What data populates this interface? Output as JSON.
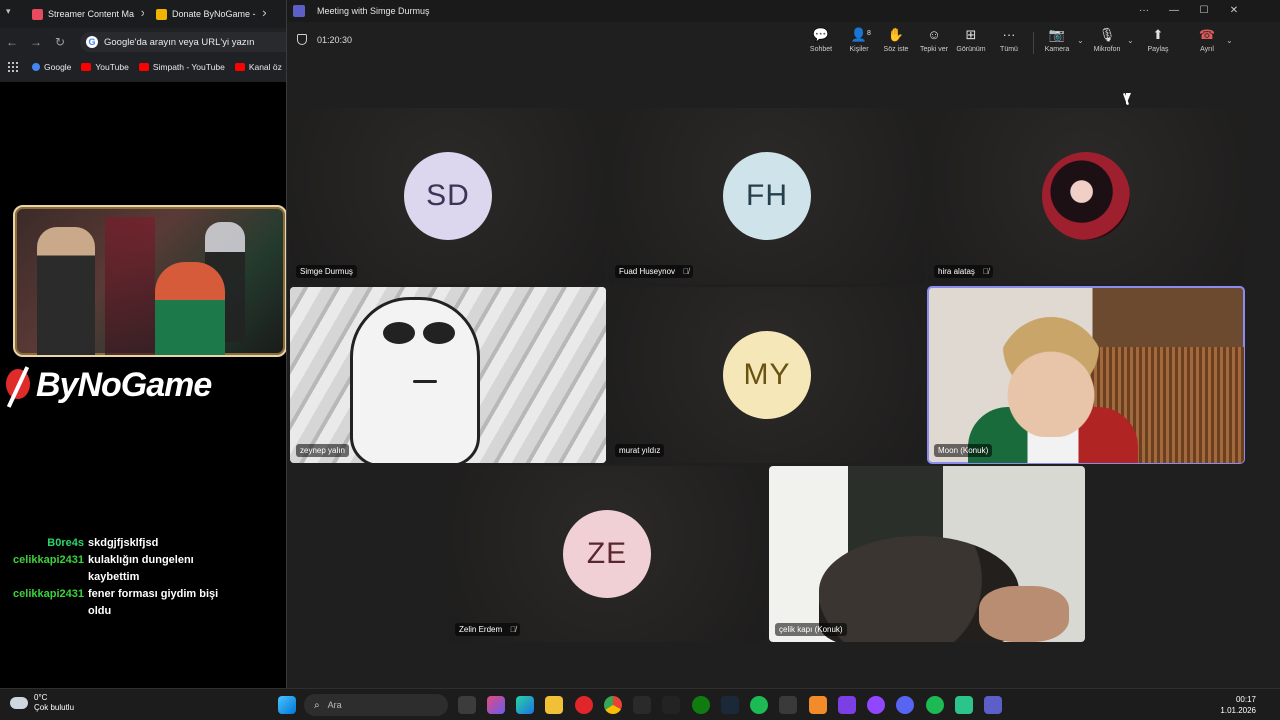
{
  "browser": {
    "tabs": [
      {
        "label": "Streamer Content Ma",
        "color": "#e84a5f"
      },
      {
        "label": "Donate ByNoGame -",
        "color": "#f0b400"
      }
    ],
    "omnibox_placeholder": "Google'da arayın veya URL'yi yazın",
    "bookmarks": [
      {
        "label": "Google",
        "color": "#4285f4"
      },
      {
        "label": "YouTube",
        "color": "#ff0000"
      },
      {
        "label": "Simpath - YouTube",
        "color": "#ff0000"
      },
      {
        "label": "Kanal öz",
        "color": "#ff0000"
      }
    ]
  },
  "overlay": {
    "brand": "ByNoGame",
    "chat": [
      {
        "user": "B0re4s",
        "text": "skdgjfjsklfjsd",
        "color": "#2bd46b"
      },
      {
        "user": "celikkapi2431",
        "text": "kulaklığın dungelenı kaybettim",
        "color": "#3ad33a"
      },
      {
        "user": "celikkapi2431",
        "text": "fener forması giydim bişi oldu",
        "color": "#3ad33a"
      }
    ]
  },
  "teams": {
    "window_title": "Meeting with Simge Durmuş",
    "timer": "01:20:30",
    "toolbar": {
      "chat": "Sohbet",
      "people": "Kişiler",
      "people_count": "8",
      "raise": "Söz iste",
      "react": "Tepki ver",
      "view": "Görünüm",
      "more": "Tümü",
      "camera": "Kamera",
      "mic": "Mikrofon",
      "share": "Paylaş",
      "leave": "Ayrıl"
    },
    "participants": [
      {
        "name": "Simge Durmuş",
        "initials": "SD",
        "bg": "#dcd6ef",
        "fg": "#3b3558",
        "muted": false
      },
      {
        "name": "Fuad Huseynov",
        "initials": "FH",
        "bg": "#cfe3ea",
        "fg": "#25404a",
        "muted": true
      },
      {
        "name": "hira alataş",
        "initials": "",
        "muted": true
      },
      {
        "name": "zeynep yalın",
        "initials": "",
        "muted": false
      },
      {
        "name": "murat yıldız",
        "initials": "MY",
        "bg": "#f6e7b8",
        "fg": "#6a5210",
        "muted": false
      },
      {
        "name": "Moon (Konuk)",
        "initials": "",
        "muted": false
      },
      {
        "name": "Zelin Erdem",
        "initials": "ZE",
        "bg": "#f0d0d4",
        "fg": "#5a2630",
        "muted": true
      },
      {
        "name": "çelik kapı (Konuk)",
        "initials": "",
        "muted": false
      }
    ]
  },
  "taskbar": {
    "weather_temp": "0°C",
    "weather_desc": "Çok bulutlu",
    "search_placeholder": "Ara",
    "time": "00:17",
    "date": "1.01.2026"
  }
}
